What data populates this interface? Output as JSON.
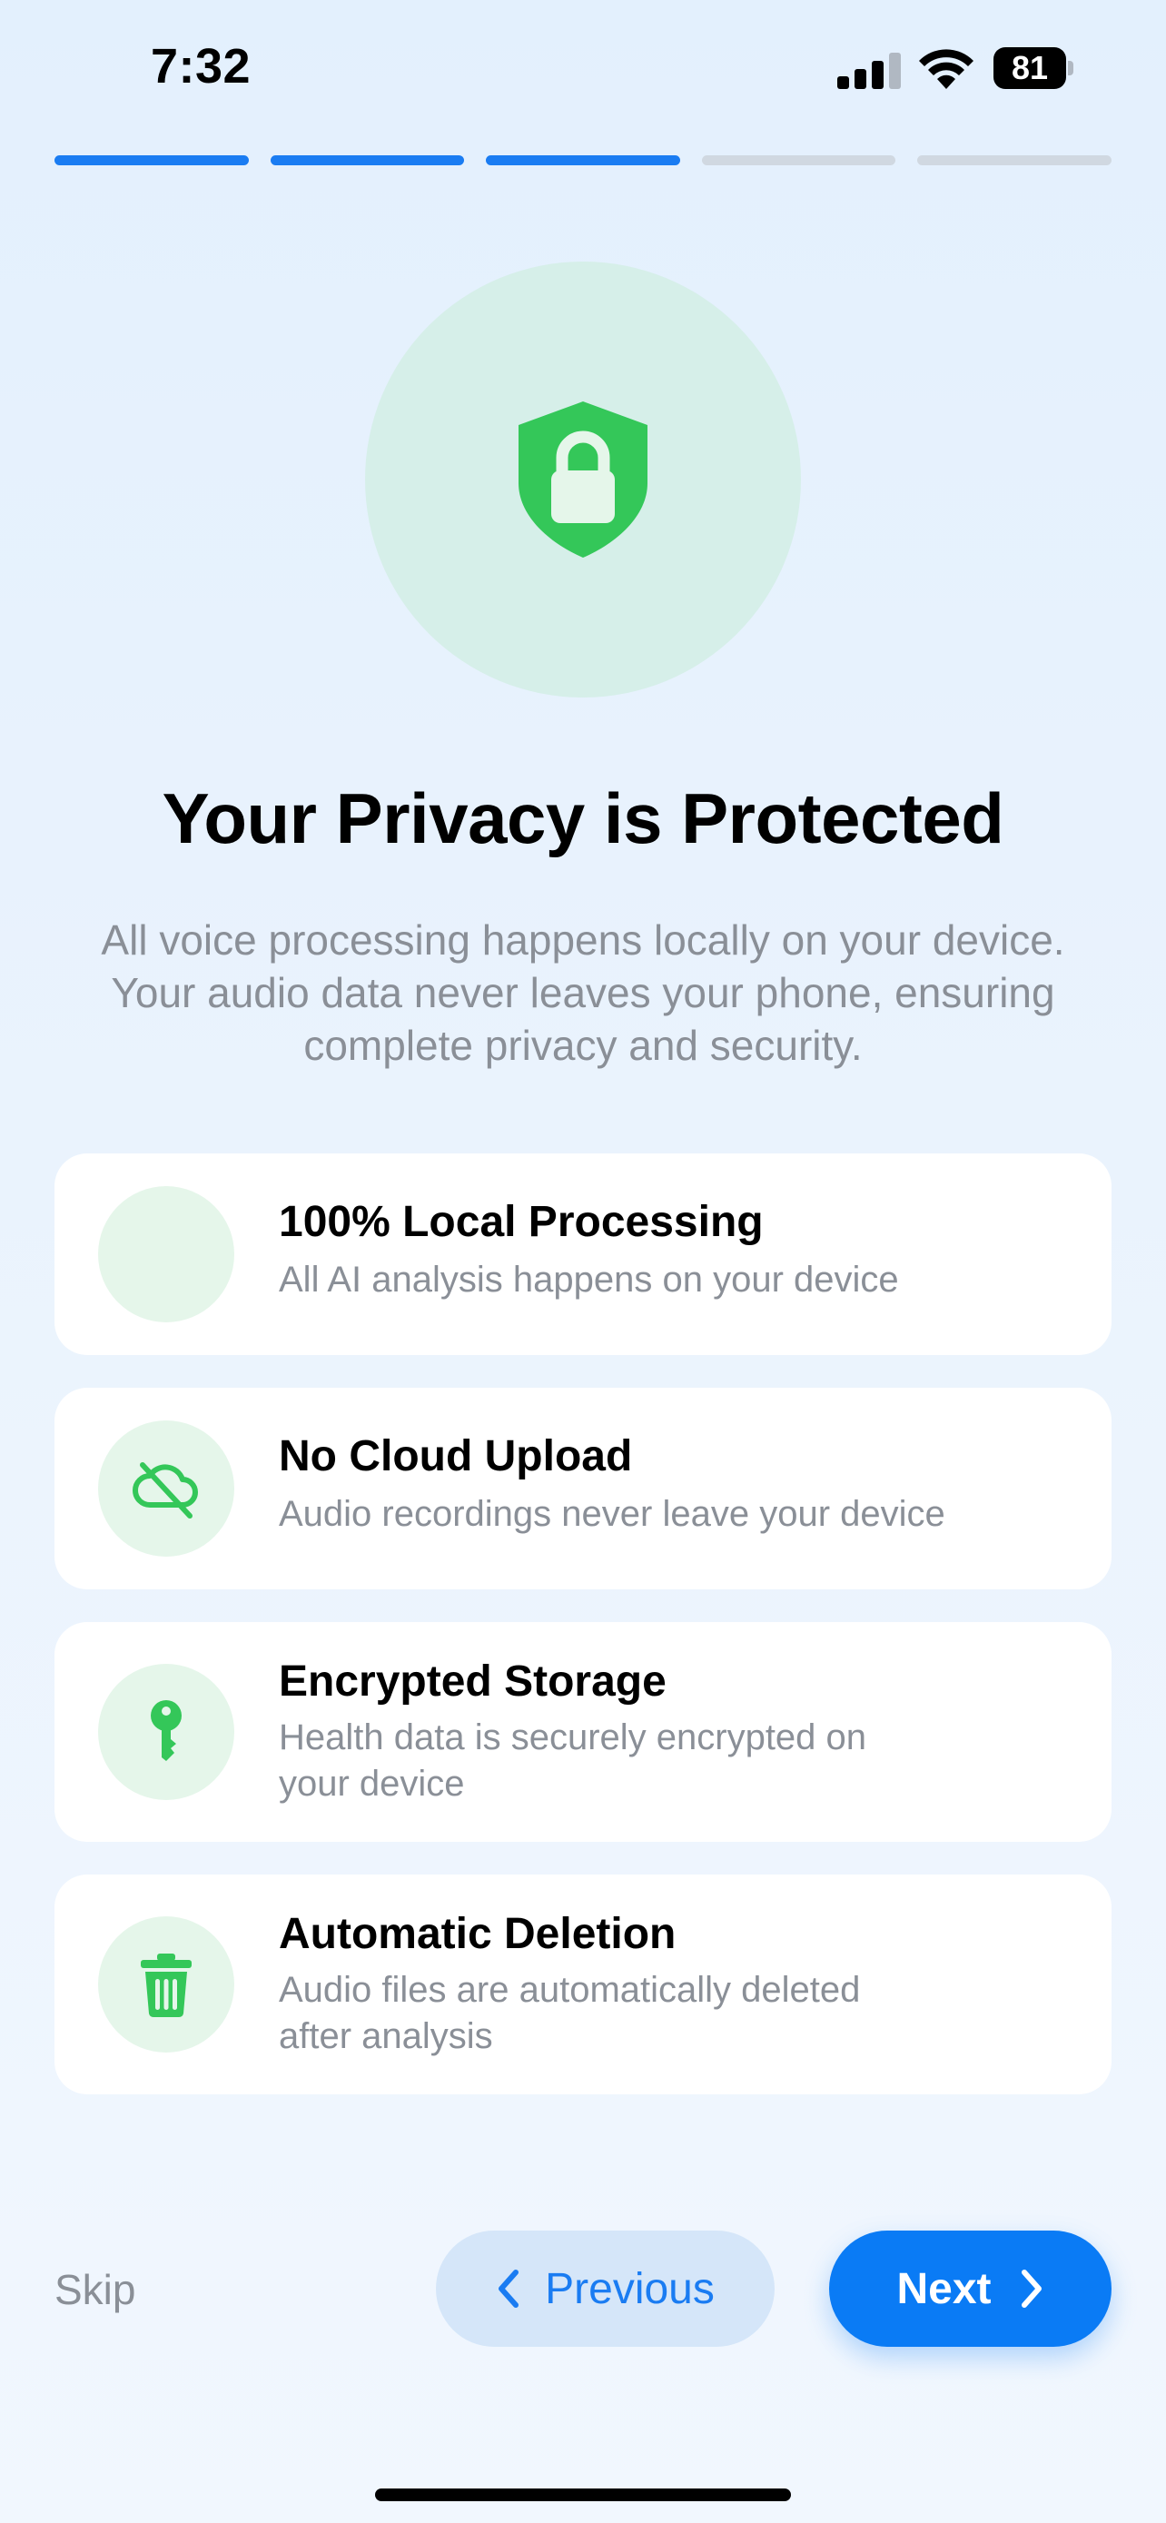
{
  "status_bar": {
    "time": "7:32",
    "battery": "81"
  },
  "progress": {
    "total_steps": 5,
    "current_step": 3,
    "active_color": "#1a7cf2",
    "inactive_color": "#d0d8e1"
  },
  "hero": {
    "icon": "shield-lock-icon",
    "title": "Your Privacy is Protected",
    "description_lines": [
      "All voice processing happens locally on your device.",
      "Your audio data never leaves your phone, ensuring",
      "complete privacy and security."
    ]
  },
  "features": [
    {
      "icon": "",
      "title": "100% Local Processing",
      "subtitle_lines": [
        "All AI analysis happens on your device"
      ]
    },
    {
      "icon": "cloud-slash-icon",
      "title": "No Cloud Upload",
      "subtitle_lines": [
        "Audio recordings never leave your device"
      ]
    },
    {
      "icon": "key-icon",
      "title": "Encrypted Storage",
      "subtitle_lines": [
        "Health data is securely encrypted on",
        "your device"
      ]
    },
    {
      "icon": "trash-icon",
      "title": "Automatic Deletion",
      "subtitle_lines": [
        "Audio files are automatically deleted",
        "after analysis"
      ]
    }
  ],
  "footer": {
    "skip_label": "Skip",
    "previous_label": "Previous",
    "next_label": "Next"
  },
  "colors": {
    "accent": "#0a7bf5",
    "green": "#34c759",
    "muted_text": "#8a8f97"
  }
}
